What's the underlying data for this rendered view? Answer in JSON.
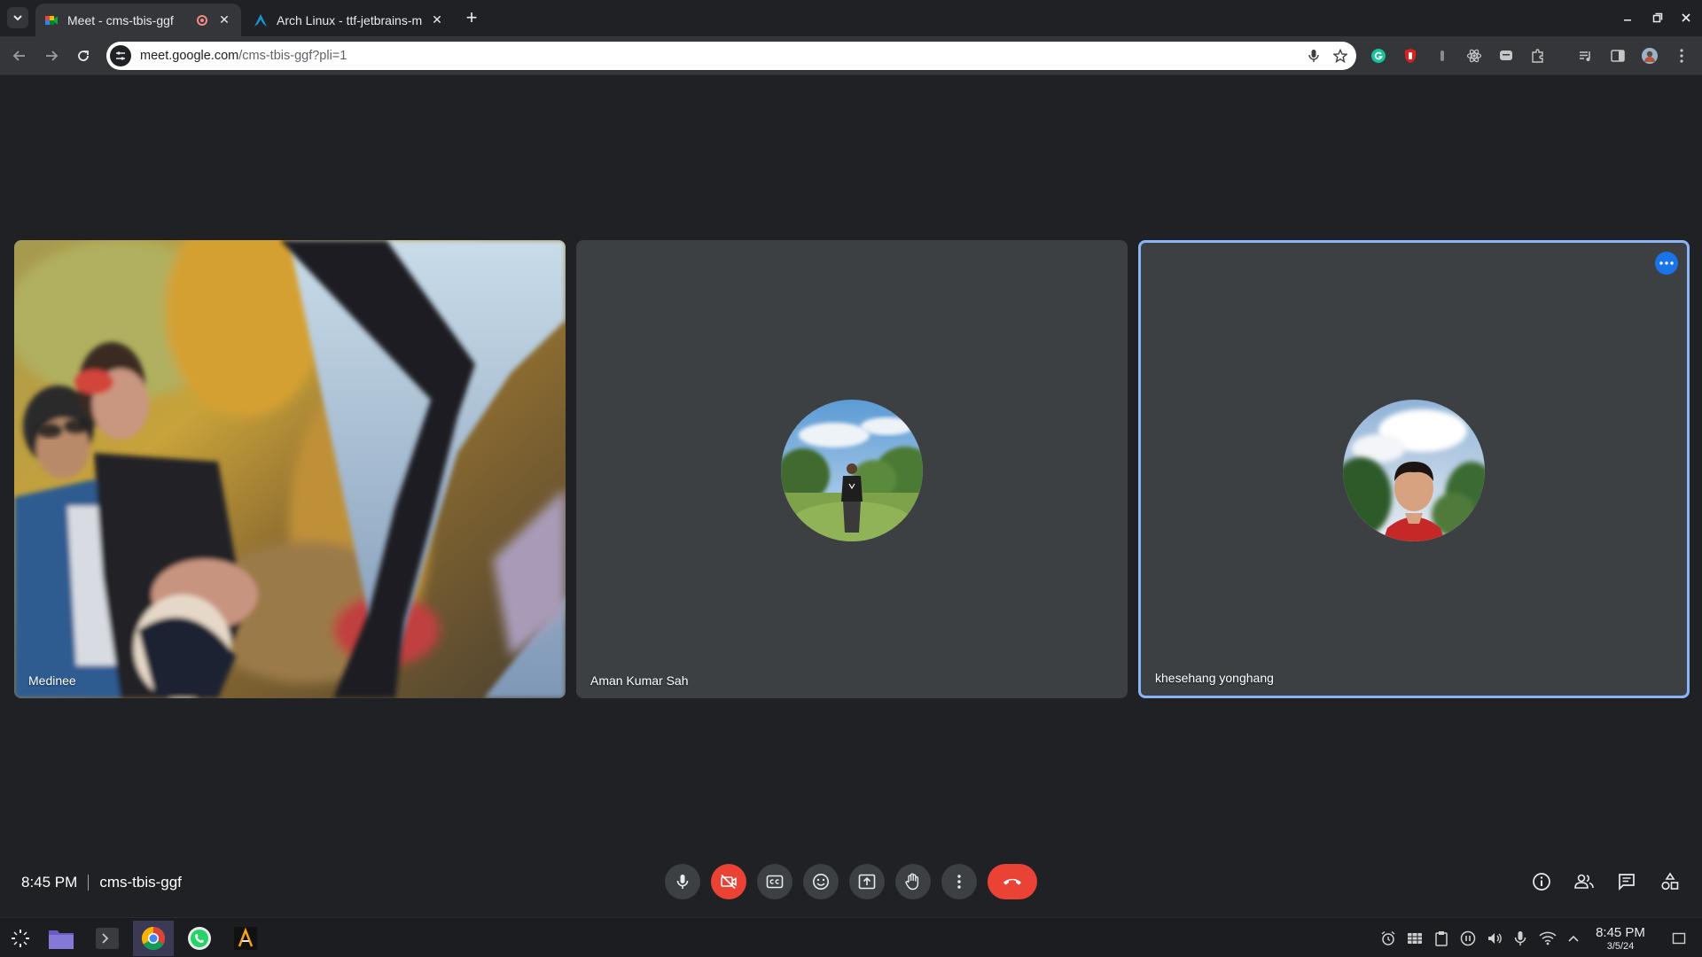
{
  "browser": {
    "tabs": [
      {
        "title": "Meet - cms-tbis-ggf",
        "active": true,
        "recording": true
      },
      {
        "title": "Arch Linux - ttf-jetbrains-m",
        "active": false
      }
    ],
    "url_host": "meet.google.com",
    "url_path": "/cms-tbis-ggf?pli=1"
  },
  "meet": {
    "participants": [
      {
        "name": "Medinee",
        "video_on": true
      },
      {
        "name": "Aman Kumar Sah",
        "video_on": false
      },
      {
        "name": "khesehang yonghang",
        "video_on": false,
        "speaking": true
      }
    ],
    "time": "8:45 PM",
    "separator": "|",
    "meeting_code": "cms-tbis-ggf",
    "people_count": "3"
  },
  "taskbar": {
    "time": "8:45 PM",
    "date": "3/5/24"
  },
  "colors": {
    "accent": "#8ab4f8",
    "hangup": "#ea4335",
    "background": "#202124",
    "tile": "#3c4043"
  }
}
